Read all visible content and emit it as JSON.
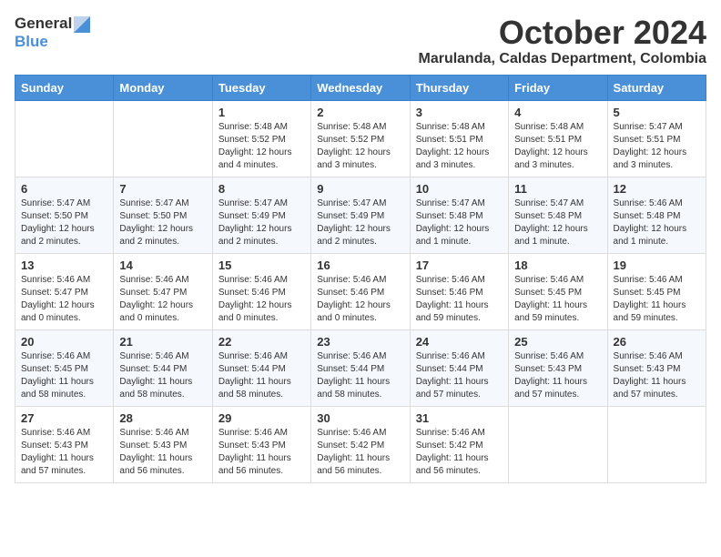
{
  "header": {
    "logo_line1": "General",
    "logo_line2": "Blue",
    "month_title": "October 2024",
    "subtitle": "Marulanda, Caldas Department, Colombia"
  },
  "weekdays": [
    "Sunday",
    "Monday",
    "Tuesday",
    "Wednesday",
    "Thursday",
    "Friday",
    "Saturday"
  ],
  "weeks": [
    [
      {
        "day": "",
        "info": ""
      },
      {
        "day": "",
        "info": ""
      },
      {
        "day": "1",
        "info": "Sunrise: 5:48 AM\nSunset: 5:52 PM\nDaylight: 12 hours and 4 minutes."
      },
      {
        "day": "2",
        "info": "Sunrise: 5:48 AM\nSunset: 5:52 PM\nDaylight: 12 hours and 3 minutes."
      },
      {
        "day": "3",
        "info": "Sunrise: 5:48 AM\nSunset: 5:51 PM\nDaylight: 12 hours and 3 minutes."
      },
      {
        "day": "4",
        "info": "Sunrise: 5:48 AM\nSunset: 5:51 PM\nDaylight: 12 hours and 3 minutes."
      },
      {
        "day": "5",
        "info": "Sunrise: 5:47 AM\nSunset: 5:51 PM\nDaylight: 12 hours and 3 minutes."
      }
    ],
    [
      {
        "day": "6",
        "info": "Sunrise: 5:47 AM\nSunset: 5:50 PM\nDaylight: 12 hours and 2 minutes."
      },
      {
        "day": "7",
        "info": "Sunrise: 5:47 AM\nSunset: 5:50 PM\nDaylight: 12 hours and 2 minutes."
      },
      {
        "day": "8",
        "info": "Sunrise: 5:47 AM\nSunset: 5:49 PM\nDaylight: 12 hours and 2 minutes."
      },
      {
        "day": "9",
        "info": "Sunrise: 5:47 AM\nSunset: 5:49 PM\nDaylight: 12 hours and 2 minutes."
      },
      {
        "day": "10",
        "info": "Sunrise: 5:47 AM\nSunset: 5:48 PM\nDaylight: 12 hours and 1 minute."
      },
      {
        "day": "11",
        "info": "Sunrise: 5:47 AM\nSunset: 5:48 PM\nDaylight: 12 hours and 1 minute."
      },
      {
        "day": "12",
        "info": "Sunrise: 5:46 AM\nSunset: 5:48 PM\nDaylight: 12 hours and 1 minute."
      }
    ],
    [
      {
        "day": "13",
        "info": "Sunrise: 5:46 AM\nSunset: 5:47 PM\nDaylight: 12 hours and 0 minutes."
      },
      {
        "day": "14",
        "info": "Sunrise: 5:46 AM\nSunset: 5:47 PM\nDaylight: 12 hours and 0 minutes."
      },
      {
        "day": "15",
        "info": "Sunrise: 5:46 AM\nSunset: 5:46 PM\nDaylight: 12 hours and 0 minutes."
      },
      {
        "day": "16",
        "info": "Sunrise: 5:46 AM\nSunset: 5:46 PM\nDaylight: 12 hours and 0 minutes."
      },
      {
        "day": "17",
        "info": "Sunrise: 5:46 AM\nSunset: 5:46 PM\nDaylight: 11 hours and 59 minutes."
      },
      {
        "day": "18",
        "info": "Sunrise: 5:46 AM\nSunset: 5:45 PM\nDaylight: 11 hours and 59 minutes."
      },
      {
        "day": "19",
        "info": "Sunrise: 5:46 AM\nSunset: 5:45 PM\nDaylight: 11 hours and 59 minutes."
      }
    ],
    [
      {
        "day": "20",
        "info": "Sunrise: 5:46 AM\nSunset: 5:45 PM\nDaylight: 11 hours and 58 minutes."
      },
      {
        "day": "21",
        "info": "Sunrise: 5:46 AM\nSunset: 5:44 PM\nDaylight: 11 hours and 58 minutes."
      },
      {
        "day": "22",
        "info": "Sunrise: 5:46 AM\nSunset: 5:44 PM\nDaylight: 11 hours and 58 minutes."
      },
      {
        "day": "23",
        "info": "Sunrise: 5:46 AM\nSunset: 5:44 PM\nDaylight: 11 hours and 58 minutes."
      },
      {
        "day": "24",
        "info": "Sunrise: 5:46 AM\nSunset: 5:44 PM\nDaylight: 11 hours and 57 minutes."
      },
      {
        "day": "25",
        "info": "Sunrise: 5:46 AM\nSunset: 5:43 PM\nDaylight: 11 hours and 57 minutes."
      },
      {
        "day": "26",
        "info": "Sunrise: 5:46 AM\nSunset: 5:43 PM\nDaylight: 11 hours and 57 minutes."
      }
    ],
    [
      {
        "day": "27",
        "info": "Sunrise: 5:46 AM\nSunset: 5:43 PM\nDaylight: 11 hours and 57 minutes."
      },
      {
        "day": "28",
        "info": "Sunrise: 5:46 AM\nSunset: 5:43 PM\nDaylight: 11 hours and 56 minutes."
      },
      {
        "day": "29",
        "info": "Sunrise: 5:46 AM\nSunset: 5:43 PM\nDaylight: 11 hours and 56 minutes."
      },
      {
        "day": "30",
        "info": "Sunrise: 5:46 AM\nSunset: 5:42 PM\nDaylight: 11 hours and 56 minutes."
      },
      {
        "day": "31",
        "info": "Sunrise: 5:46 AM\nSunset: 5:42 PM\nDaylight: 11 hours and 56 minutes."
      },
      {
        "day": "",
        "info": ""
      },
      {
        "day": "",
        "info": ""
      }
    ]
  ]
}
